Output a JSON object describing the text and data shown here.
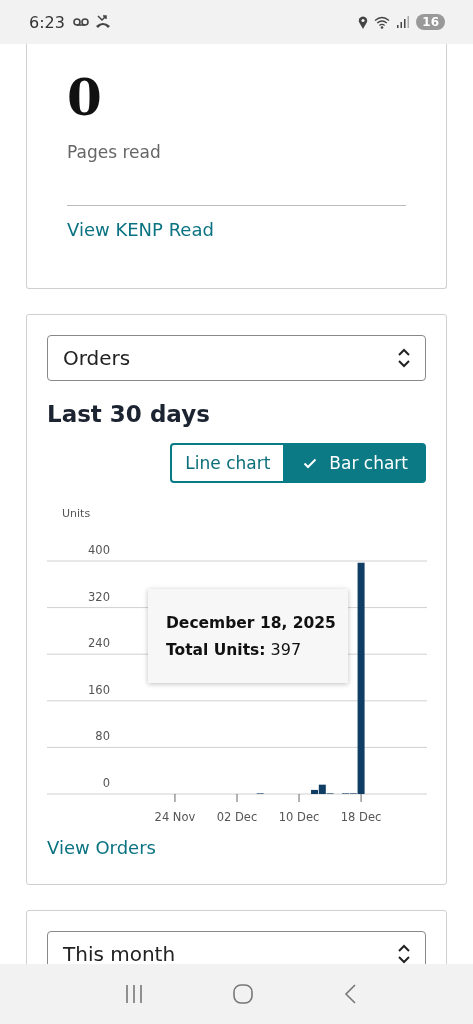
{
  "status_bar": {
    "time": "6:23",
    "battery": "16"
  },
  "kenp_card": {
    "value": "0",
    "label": "Pages read",
    "link": "View KENP Read"
  },
  "orders_card": {
    "dropdown": {
      "value": "Orders"
    },
    "title": "Last 30 days",
    "chart_toggle": [
      {
        "label": "Line chart",
        "selected": false
      },
      {
        "label": "Bar chart",
        "selected": true
      }
    ],
    "chart_data": {
      "type": "bar",
      "ylabel": "Units",
      "categories": [
        null,
        null,
        null,
        null,
        null,
        null,
        null,
        null,
        null,
        null,
        null,
        null,
        null,
        null,
        null,
        null,
        "24 Nov",
        null,
        null,
        null,
        null,
        null,
        null,
        null,
        "02 Dec",
        null,
        null,
        null,
        null,
        null,
        null,
        null,
        "10 Dec",
        null,
        null,
        null,
        null,
        null,
        null,
        null,
        "18 Dec",
        null,
        null,
        null,
        null,
        null,
        null,
        null,
        null
      ],
      "series": [
        {
          "color": "#0f3d63",
          "values": [
            null,
            null,
            null,
            null,
            null,
            null,
            null,
            null,
            null,
            null,
            null,
            0,
            0,
            0,
            0,
            0,
            0,
            0,
            0,
            0,
            0,
            0,
            0,
            0,
            0,
            0,
            0,
            1,
            0,
            0,
            0,
            0,
            0,
            0,
            7,
            16,
            1,
            0,
            1,
            1,
            397,
            null,
            null,
            null,
            null,
            null,
            null,
            null,
            null
          ]
        }
      ],
      "ylim": [
        0,
        400
      ],
      "grid": true,
      "yticks": [
        0,
        80,
        160,
        240,
        320,
        400
      ]
    },
    "tooltip": {
      "date": "December 18, 2025",
      "label": "Total Units:",
      "value": "397"
    },
    "link": "View Orders"
  },
  "next_card": {
    "dropdown": {
      "value": "This month"
    }
  }
}
